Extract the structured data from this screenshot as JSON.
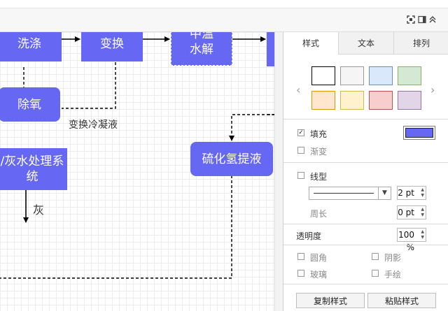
{
  "toolbar": {
    "icons": [
      "fit-screen-icon",
      "format-panel-icon",
      "collapse-icon"
    ]
  },
  "canvas": {
    "nodes": {
      "wash": "洗涤",
      "shift": "变换",
      "hydrolysis_top": "中温",
      "hydrolysis": "水解",
      "deoxy": "除氧",
      "ash_water_line1": "/灰水处理系",
      "ash_water_line2": "统",
      "h2s": "硫化氢提液"
    },
    "labels": {
      "condensate": "变换冷凝液",
      "ash": "灰"
    }
  },
  "panel": {
    "tabs": [
      "样式",
      "文本",
      "排列"
    ],
    "active_tab": "样式",
    "swatches": [
      {
        "fill": "#ffffff",
        "border": "#000000"
      },
      {
        "fill": "#f5f5f5",
        "border": "#999999"
      },
      {
        "fill": "#dae8fc",
        "border": "#6c8ebf"
      },
      {
        "fill": "#d5e8d4",
        "border": "#82b366"
      },
      {
        "fill": "#ffe6cc",
        "border": "#d79b00"
      },
      {
        "fill": "#fff2cc",
        "border": "#d6b656"
      },
      {
        "fill": "#f8cecc",
        "border": "#b85450"
      },
      {
        "fill": "#e1d5e7",
        "border": "#9673a6"
      }
    ],
    "fill": {
      "label": "填充",
      "checked": true,
      "color": "#6667f2"
    },
    "gradient": {
      "label": "渐变",
      "checked": false
    },
    "line": {
      "label": "线型",
      "checked": false,
      "width": "2 pt"
    },
    "perimeter": {
      "label": "周长",
      "value": "0 pt"
    },
    "opacity": {
      "label": "透明度",
      "value": "100 %"
    },
    "rounded": {
      "label": "圆角"
    },
    "shadow": {
      "label": "阴影"
    },
    "glass": {
      "label": "玻璃"
    },
    "sketch": {
      "label": "手绘"
    },
    "copy_style": "复制样式",
    "paste_style": "粘贴样式"
  }
}
